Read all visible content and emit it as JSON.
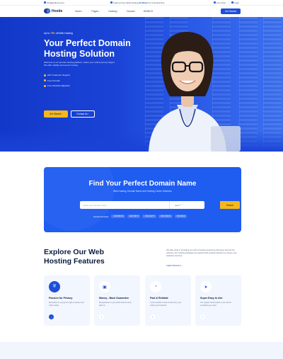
{
  "topbar": {
    "email": "info@justhost.com",
    "promo_prefix": "Avail up Free Web Hosting",
    "promo_price": "$1.00/mo",
    "promo_suffix": "for a limited time",
    "live_chat": "Live Chat",
    "login": "Login"
  },
  "nav": {
    "brand": "Hostie",
    "items": [
      {
        "label": "Home",
        "dropdown": true
      },
      {
        "label": "Pages",
        "dropdown": true
      },
      {
        "label": "Hosting",
        "dropdown": true
      },
      {
        "label": "Domain",
        "dropdown": false
      },
      {
        "label": "WHMCS",
        "dropdown": false
      }
    ],
    "cta": "Get Started"
  },
  "hero": {
    "kicker_prefix": "Up to",
    "kicker_highlight": "75%",
    "kicker_suffix": "off Web Hosting",
    "title": "Your Perfect Domain Hosting Solution",
    "description": "Welcome to our premier hosting platform, where your online journey begins. We offer reliable and secure hosting.",
    "features": [
      "24/7 Customer Support",
      "Free Domain",
      "Free Website Migration"
    ],
    "primary_button": "Get Started",
    "secondary_button": "Contact Us"
  },
  "domain_search": {
    "title": "Find Your Perfect Domain Name",
    "subtitle": "Web Hosting, Domain Name and Hosting Center Solutions",
    "placeholder": "Enter your domain name",
    "tld_selected": ".com",
    "button": "Search",
    "popular_label": "Popular Domains:",
    "popular": [
      ".COM $5.99",
      ".NET $8.75",
      ".ORG $9.75",
      ".INFO $6.99",
      ".BIZ $8.99"
    ]
  },
  "features": {
    "heading": "Explore Our Web Hosting Features",
    "description": "We take pride in providing you with a hosting experience that goes beyond the ordinary. Our hosting packages are packed with powerful features to ensure your website's success.",
    "view_details": "VIEW DETAILS",
    "cards": [
      {
        "title": "Passion for Privacy",
        "text": "We believe in everyone's right to privacy and online safety.",
        "icon": "shield-icon"
      },
      {
        "title": "Money - Back Guarantee",
        "text": "We guarantee in you which have to worry about it.",
        "icon": "wallet-icon"
      },
      {
        "title": "Fast & Reliable",
        "text": "If your website is slow to load, then your visitors get frustrated.",
        "icon": "speedometer-icon"
      },
      {
        "title": "Super Easy to Use",
        "text": "Our support control panel is one tool for everything you need.",
        "icon": "cursor-icon"
      }
    ]
  },
  "colors": {
    "brand_blue": "#1d4ed8",
    "accent_yellow": "#f6b818",
    "heading_navy": "#0b1b3f"
  }
}
